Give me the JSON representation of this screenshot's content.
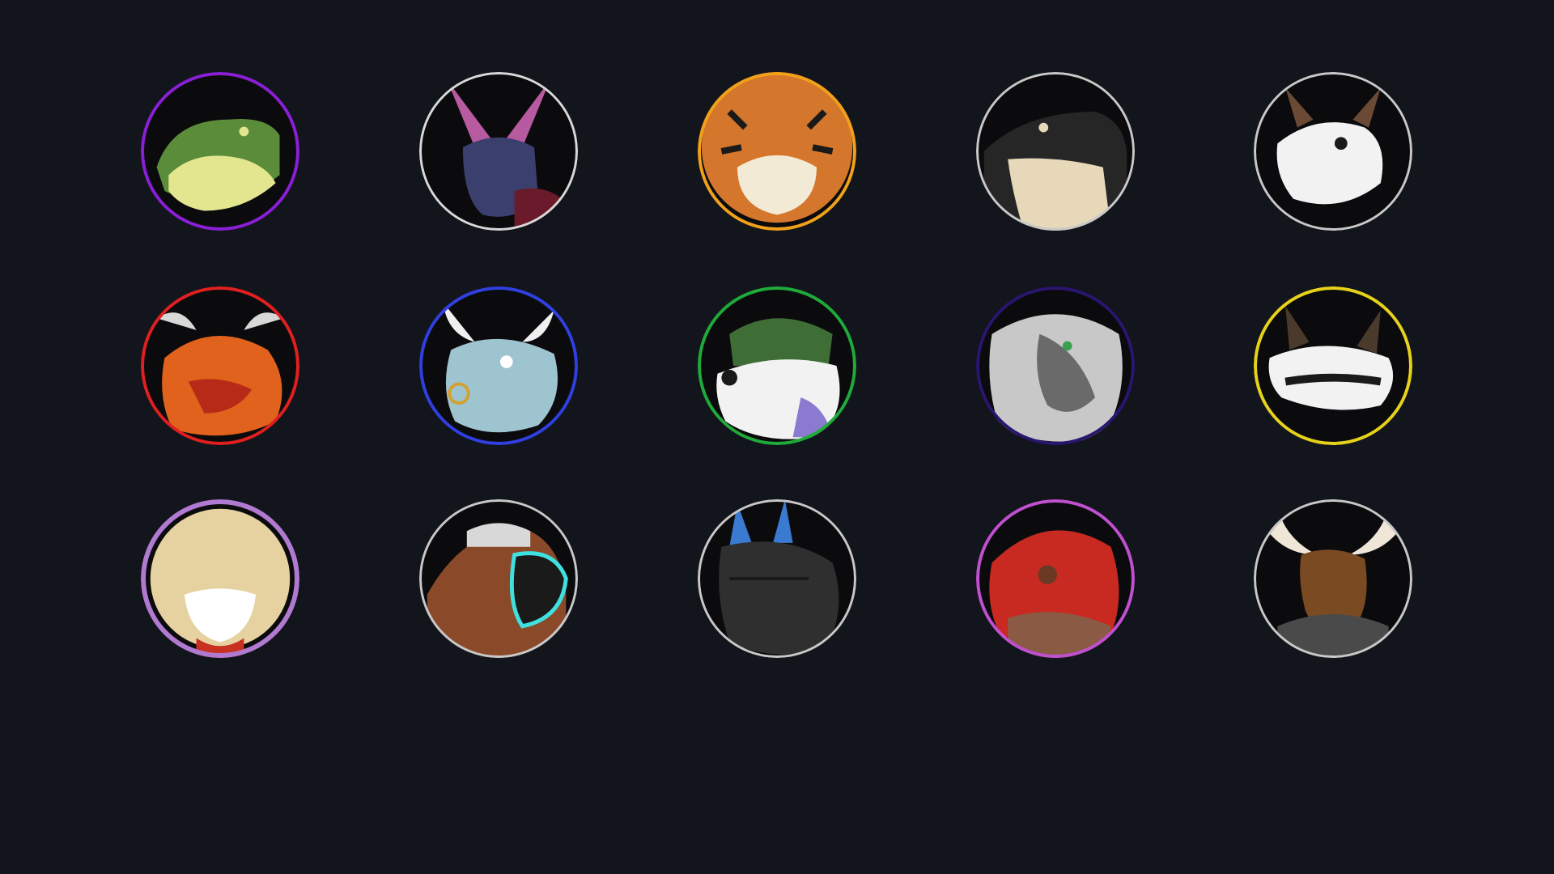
{
  "page": {
    "background": "#13151c"
  },
  "avatars": [
    {
      "icon": "crocodile-portrait-icon",
      "ring": "#8a1fd6",
      "skin": "#5b8c3a",
      "accent": "#e3e58f"
    },
    {
      "icon": "bat-portrait-icon",
      "ring": "#d8d8d8",
      "skin": "#3a3f6e",
      "accent": "#b85aa0"
    },
    {
      "icon": "tiger-portrait-icon",
      "ring": "#f0a01a",
      "skin": "#d4762b",
      "accent": "#f3ead6"
    },
    {
      "icon": "black-lizard-portrait-icon",
      "ring": "#c8c8c8",
      "skin": "#262626",
      "accent": "#e6d8b8"
    },
    {
      "icon": "skull-mask-hyena-portrait-icon",
      "ring": "#c8c8c8",
      "skin": "#6a4a34",
      "accent": "#f2f2f2"
    },
    {
      "icon": "orange-dragon-portrait-icon",
      "ring": "#e02020",
      "skin": "#e0621c",
      "accent": "#d8d8d8"
    },
    {
      "icon": "blue-bull-portrait-icon",
      "ring": "#3040e0",
      "skin": "#9ec4cf",
      "accent": "#f0f0f0"
    },
    {
      "icon": "horned-wolf-portrait-icon",
      "ring": "#1faa3a",
      "skin": "#f2f2f2",
      "accent": "#3f6d36"
    },
    {
      "icon": "white-wolf-portrait-icon",
      "ring": "#2a1570",
      "skin": "#c8c8c8",
      "accent": "#6a6a6a"
    },
    {
      "icon": "skull-mask-wolf-portrait-icon",
      "ring": "#e6d21a",
      "skin": "#4a3a2c",
      "accent": "#f2f2f2"
    },
    {
      "icon": "sabertooth-portrait-icon",
      "ring": "#b07ad0",
      "skin": "#e6d2a0",
      "accent": "#c83020"
    },
    {
      "icon": "cyber-trex-portrait-icon",
      "ring": "#c8c8c8",
      "skin": "#8a4a2a",
      "accent": "#3ee0e0"
    },
    {
      "icon": "dark-dragon-portrait-icon",
      "ring": "#c8c8c8",
      "skin": "#2f2f2f",
      "accent": "#3a7ad0"
    },
    {
      "icon": "red-dragon-portrait-icon",
      "ring": "#c050d0",
      "skin": "#c82a22",
      "accent": "#8a5a44"
    },
    {
      "icon": "moose-portrait-icon",
      "ring": "#c8c8c8",
      "skin": "#7a4a22",
      "accent": "#efe6d8"
    }
  ]
}
